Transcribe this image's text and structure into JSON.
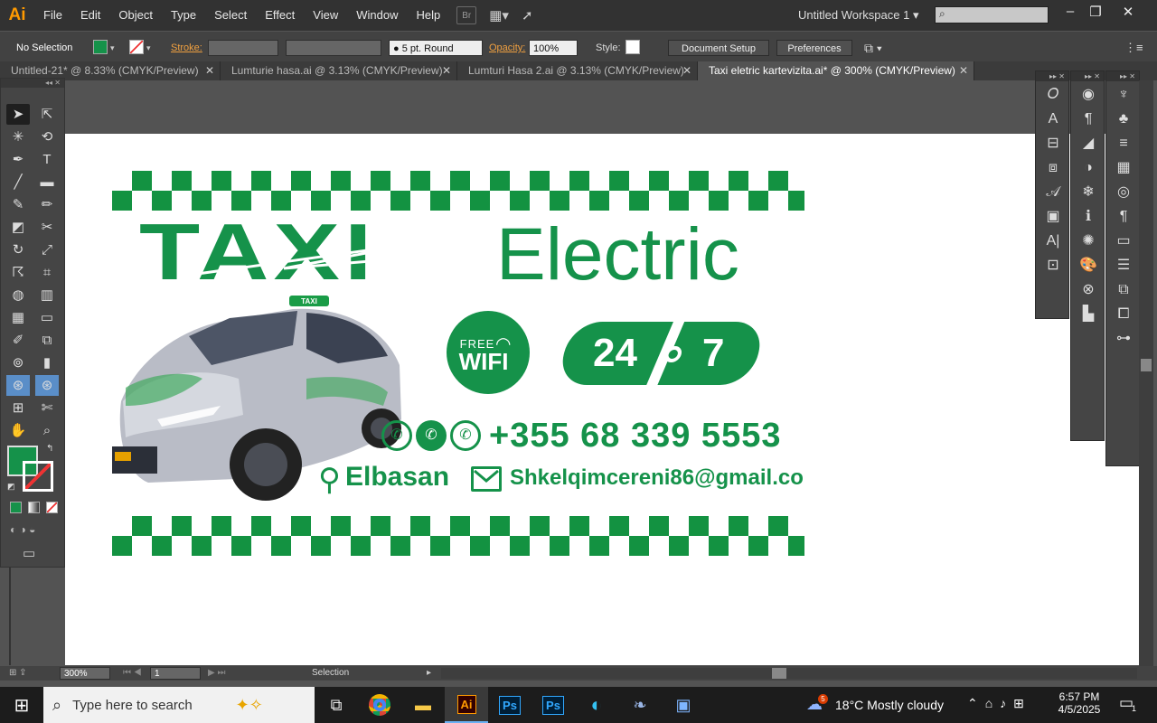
{
  "app": {
    "logo": "Ai",
    "menus": [
      "File",
      "Edit",
      "Object",
      "Type",
      "Select",
      "Effect",
      "View",
      "Window",
      "Help"
    ],
    "bridge": "Br",
    "workspace": "Untitled Workspace 1"
  },
  "control": {
    "selection": "No Selection",
    "stroke_label": "Stroke:",
    "brush": "5 pt. Round",
    "opacity_label": "Opacity:",
    "opacity": "100%",
    "style_label": "Style:",
    "doc_setup": "Document Setup",
    "preferences": "Preferences",
    "fill_color": "#15924a"
  },
  "tabs": [
    {
      "label": "Untitled-21* @ 8.33% (CMYK/Preview)"
    },
    {
      "label": "Lumturie hasa.ai @ 3.13% (CMYK/Preview)"
    },
    {
      "label": "Lumturi Hasa 2.ai @ 3.13% (CMYK/Preview)"
    },
    {
      "label": "Taxi eletric kartevizita.ai* @ 300% (CMYK/Preview)"
    }
  ],
  "card": {
    "title_left": "TAXI",
    "title_right": "Electric",
    "wifi_top": "FREE",
    "wifi_main": "WIFI",
    "hours_left": "24",
    "hours_right": "7",
    "phone": "+355 68 339 5553",
    "city": "Elbasan",
    "email": "Shkelqimcereni86@gmail.com",
    "taxi_sign": "TAXI",
    "brand_color": "#15924a"
  },
  "status": {
    "zoom": "300%",
    "page": "1",
    "tool": "Selection"
  },
  "taskbar": {
    "search_placeholder": "Type here to search",
    "weather_temp": "18°C",
    "weather_text": "Mostly cloudy",
    "weather_badge": "5",
    "time": "6:57 PM",
    "date": "4/5/2025",
    "notif": "1"
  }
}
